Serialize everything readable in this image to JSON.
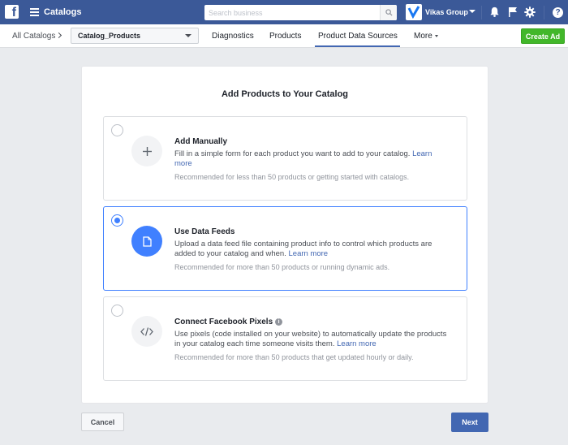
{
  "topbar": {
    "app_title": "Catalogs",
    "search_placeholder": "Search business",
    "account_name": "Vikas Group",
    "help_label": "?"
  },
  "subnav": {
    "breadcrumb": "All Catalogs",
    "catalog_selected": "Catalog_Products",
    "tabs": [
      {
        "label": "Diagnostics",
        "active": false
      },
      {
        "label": "Products",
        "active": false
      },
      {
        "label": "Product Data Sources",
        "active": true
      },
      {
        "label": "More",
        "active": false
      }
    ],
    "create_ad_label": "Create Ad"
  },
  "card": {
    "title": "Add Products to Your Catalog",
    "options": [
      {
        "title": "Add Manually",
        "description": "Fill in a simple form for each product you want to add to your catalog.",
        "link": "Learn more",
        "note": "Recommended for less than 50 products or getting started with catalogs.",
        "icon": "plus-icon",
        "selected": false
      },
      {
        "title": "Use Data Feeds",
        "description": "Upload a data feed file containing product info to control which products are added to your catalog and when.",
        "link": "Learn more",
        "note": "Recommended for more than 50 products or running dynamic ads.",
        "icon": "file-icon",
        "selected": true
      },
      {
        "title": "Connect Facebook Pixels",
        "description": "Use pixels (code installed on your website) to automatically update the products in your catalog each time someone visits them.",
        "link": "Learn more",
        "note": "Recommended for more than 50 products that get updated hourly or daily.",
        "icon": "code-icon",
        "selected": false
      }
    ]
  },
  "footer": {
    "cancel_label": "Cancel",
    "next_label": "Next"
  },
  "colors": {
    "brand": "#3b5998",
    "accent": "#4080ff",
    "primary_button": "#4267b2",
    "create_button": "#42b72a"
  }
}
